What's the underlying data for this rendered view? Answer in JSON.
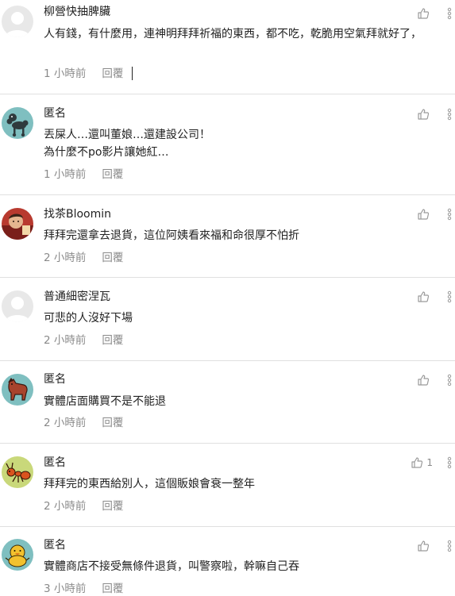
{
  "comments": [
    {
      "author": "柳營快抽脾臟",
      "text": "人有錢，有什麼用，連神明拜拜祈福的東西，都不吃，乾脆用空氣拜就好了，",
      "time": "1 小時前",
      "reply": "回覆",
      "likes": "",
      "avatar": "default-avatar"
    },
    {
      "author": "匿名",
      "text": "丟屎人…還叫董娘…還建設公司！\n為什麼不po影片讓她紅…",
      "time": "1 小時前",
      "reply": "回覆",
      "likes": "",
      "avatar": "poodle-avatar"
    },
    {
      "author": "找茶Bloomin",
      "text": "拜拜完還拿去退貨，這位阿姨看來福和命很厚不怕折",
      "time": "2 小時前",
      "reply": "回覆",
      "likes": "",
      "avatar": "photo-avatar"
    },
    {
      "author": "普通細密涅瓦",
      "text": "可悲的人沒好下場",
      "time": "2 小時前",
      "reply": "回覆",
      "likes": "",
      "avatar": "default-avatar"
    },
    {
      "author": "匿名",
      "text": "實體店面購買不是不能退",
      "time": "2 小時前",
      "reply": "回覆",
      "likes": "",
      "avatar": "horse-avatar"
    },
    {
      "author": "匿名",
      "text": "拜拜完的東西給別人，這個販娘會衰一整年",
      "time": "2 小時前",
      "reply": "回覆",
      "likes": "1",
      "avatar": "ant-avatar"
    },
    {
      "author": "匿名",
      "text": "實體商店不接受無條件退貨，叫警察啦，幹嘛自己吞",
      "time": "3 小時前",
      "reply": "回覆",
      "likes": "",
      "avatar": "chick-avatar"
    }
  ],
  "colors": {
    "meta": "#8a8a8a",
    "divider": "#e0e0e0",
    "avatar_bg": "#7fbfc0"
  }
}
